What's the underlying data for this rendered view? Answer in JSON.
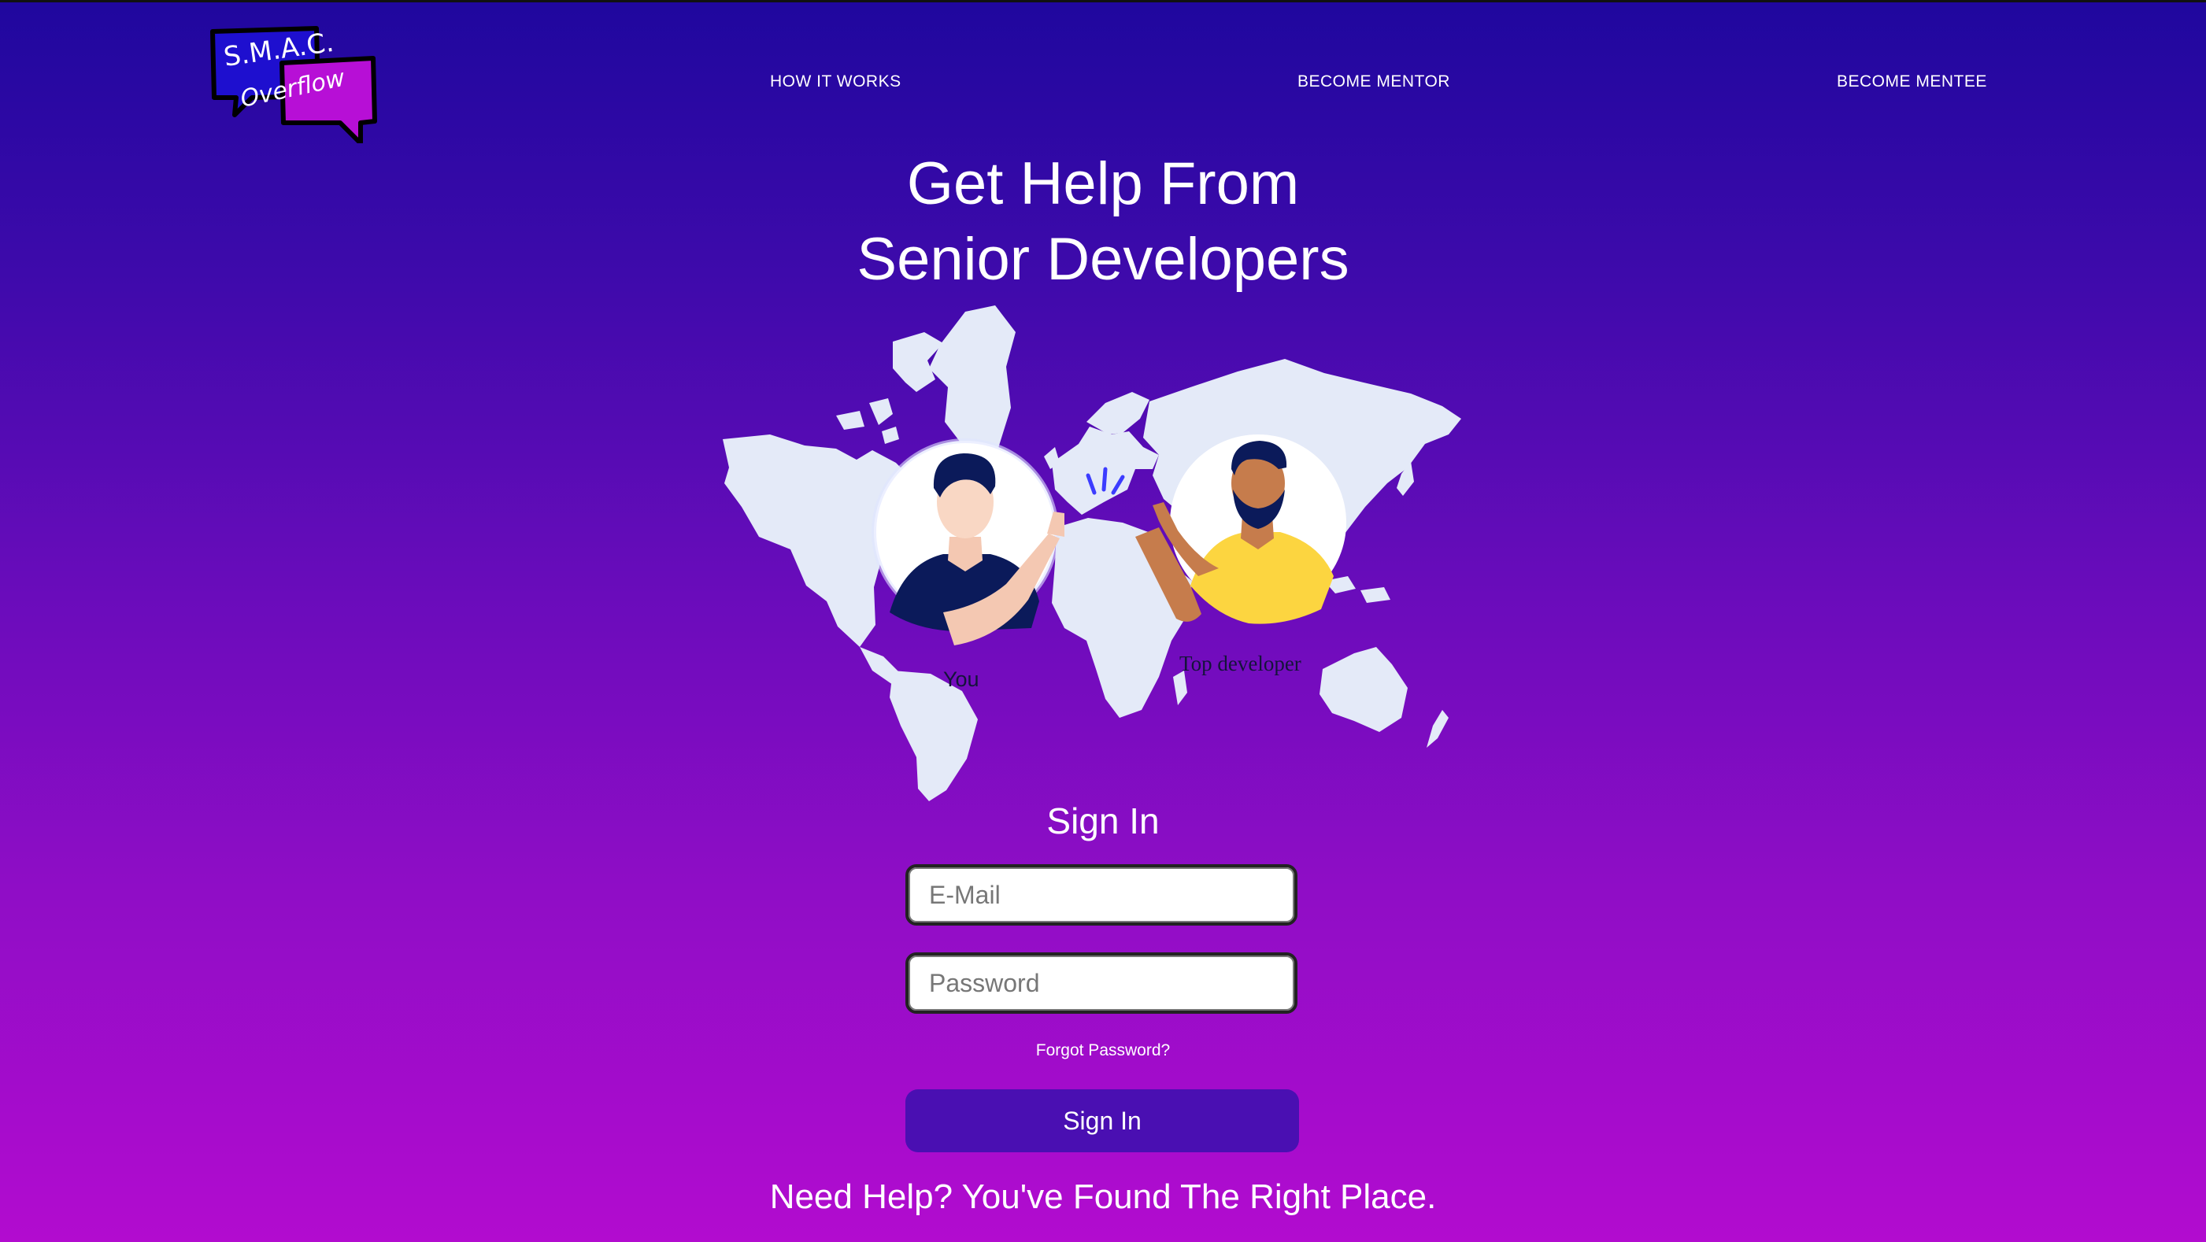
{
  "logo": {
    "line1": "S.M.A.C.",
    "line2": "Overflow",
    "colors": {
      "bubble_left": "#1e0fcf",
      "bubble_right": "#b70fd6",
      "outline": "#000000"
    }
  },
  "nav": {
    "how_it_works": "HOW IT WORKS",
    "become_mentor": "BECOME MENTOR",
    "become_mentee": "BECOME MENTEE"
  },
  "hero": {
    "title_line1": "Get Help From",
    "title_line2": "Senior Developers"
  },
  "illustration": {
    "left_caption": "You",
    "right_caption": "Top developer",
    "icons": [
      "world-map",
      "person-avatar-you",
      "person-avatar-developer",
      "high-five-spark"
    ]
  },
  "signin": {
    "heading": "Sign In",
    "email_placeholder": "E-Mail",
    "password_placeholder": "Password",
    "forgot_password": "Forgot Password?",
    "button_label": "Sign In"
  },
  "tagline": "Need Help? You've Found The Right Place.",
  "colors": {
    "background_top": "#1f079e",
    "background_bottom": "#b20ccf",
    "button": "#4a0fb2",
    "map": "#e4eaf8"
  }
}
